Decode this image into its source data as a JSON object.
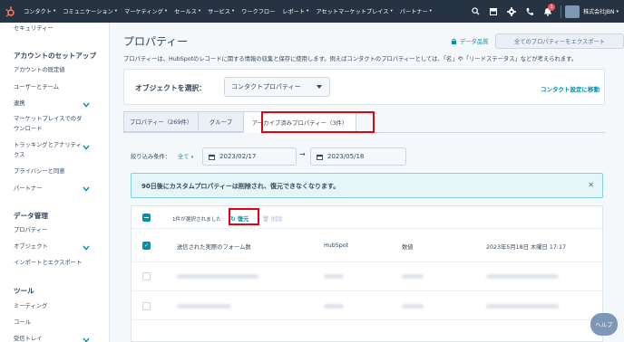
{
  "topnav": {
    "items": [
      "コンタクト",
      "コミュニケーション",
      "マーケティング",
      "セールス",
      "サービス",
      "ワークフロー",
      "レポート",
      "アセットマーケットプレイス",
      "パートナー"
    ],
    "has_caret": [
      true,
      true,
      true,
      true,
      true,
      false,
      true,
      true,
      true
    ],
    "notification_count": "1",
    "account_name": "株式会社JBN"
  },
  "sidebar": {
    "top_item": "セキュリティー",
    "section1": {
      "title": "アカウントのセットアップ",
      "items": [
        "アカウントの既定値",
        "ユーザーとチーム",
        "連携",
        "マーケットプレイスでのダ",
        "ウンロード",
        "トラッキングとアナリティ",
        "クス",
        "プライバシーと同意",
        "パートナー"
      ]
    },
    "section2": {
      "title": "データ管理",
      "items": [
        "プロパティー",
        "オブジェクト",
        "インポートとエクスポート"
      ]
    },
    "section3": {
      "title": "ツール",
      "items": [
        "ミーティング",
        "コール",
        "受信トレイ"
      ]
    }
  },
  "main": {
    "title": "プロパティー",
    "data_quality_label": "データ品質",
    "export_button": "全てのプロパティーをエクスポート",
    "description": "プロパティーは、HubSpotのレコードに関する情報の収集と保存に使用します。例えばコンタクトのプロパティーとしては、「名」や「リードステータス」などが考えられます。",
    "object_label": "オブジェクトを選択：",
    "object_value": "コンタクトプロパティー",
    "object_link": "コンタクト設定に移動",
    "tabs": [
      "プロパティー（269件）",
      "グループ",
      "アーカイブ済みプロパティー（3件）"
    ],
    "filter": {
      "label": "絞り込み条件：",
      "value": "全て",
      "date_from": "2023/02/17",
      "date_to": "2023/05/18"
    },
    "alert": "90日後にカスタムプロパティーは削除され、復元できなくなります。",
    "table": {
      "selected_text": "1件が選択されました",
      "restore_label": "復元",
      "delete_label": "削除",
      "row1": {
        "name": "送信された実際のフォーム数",
        "group": "HubSpot",
        "type": "数値",
        "date": "2023年5月18日 木曜日 17:17"
      }
    }
  },
  "help_label": "ヘルプ",
  "colors": {
    "nav_bg": "#253342",
    "link": "#0091ae",
    "highlight": "#e3000f",
    "logo": "#ff7a59"
  }
}
